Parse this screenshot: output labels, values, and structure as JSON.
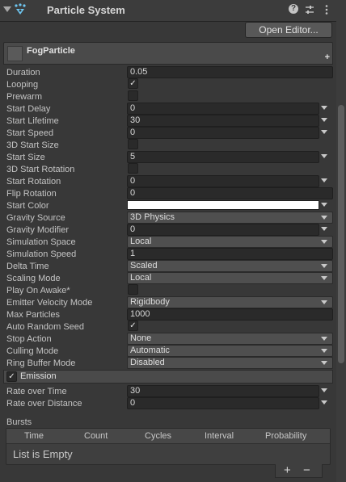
{
  "header": {
    "title": "Particle System"
  },
  "open_editor_label": "Open Editor...",
  "module_title": "FogParticle",
  "main": {
    "duration": {
      "label": "Duration",
      "value": "0.05"
    },
    "looping": {
      "label": "Looping",
      "checked": true
    },
    "prewarm": {
      "label": "Prewarm",
      "checked": false
    },
    "start_delay": {
      "label": "Start Delay",
      "value": "0"
    },
    "start_lifetime": {
      "label": "Start Lifetime",
      "value": "30"
    },
    "start_speed": {
      "label": "Start Speed",
      "value": "0"
    },
    "start_size_3d": {
      "label": "3D Start Size",
      "checked": false
    },
    "start_size": {
      "label": "Start Size",
      "value": "5"
    },
    "start_rotation_3d": {
      "label": "3D Start Rotation",
      "checked": false
    },
    "start_rotation": {
      "label": "Start Rotation",
      "value": "0"
    },
    "flip_rotation": {
      "label": "Flip Rotation",
      "value": "0"
    },
    "start_color": {
      "label": "Start Color",
      "color": "#ffffff"
    },
    "gravity_source": {
      "label": "Gravity Source",
      "value": "3D Physics"
    },
    "gravity_modifier": {
      "label": "Gravity Modifier",
      "value": "0"
    },
    "simulation_space": {
      "label": "Simulation Space",
      "value": "Local"
    },
    "simulation_speed": {
      "label": "Simulation Speed",
      "value": "1"
    },
    "delta_time": {
      "label": "Delta Time",
      "value": "Scaled"
    },
    "scaling_mode": {
      "label": "Scaling Mode",
      "value": "Local"
    },
    "play_on_awake": {
      "label": "Play On Awake*",
      "checked": false
    },
    "emitter_velocity_mode": {
      "label": "Emitter Velocity Mode",
      "value": "Rigidbody"
    },
    "max_particles": {
      "label": "Max Particles",
      "value": "1000"
    },
    "auto_random_seed": {
      "label": "Auto Random Seed",
      "checked": true
    },
    "stop_action": {
      "label": "Stop Action",
      "value": "None"
    },
    "culling_mode": {
      "label": "Culling Mode",
      "value": "Automatic"
    },
    "ring_buffer_mode": {
      "label": "Ring Buffer Mode",
      "value": "Disabled"
    }
  },
  "emission": {
    "title": "Emission",
    "enabled": true,
    "rate_over_time": {
      "label": "Rate over Time",
      "value": "30"
    },
    "rate_over_distance": {
      "label": "Rate over Distance",
      "value": "0"
    },
    "bursts": {
      "label": "Bursts",
      "columns": [
        "Time",
        "Count",
        "Cycles",
        "Interval",
        "Probability"
      ],
      "empty_text": "List is Empty",
      "add_label": "+",
      "remove_label": "−"
    }
  },
  "colors": {
    "panel_bg": "#383838",
    "field_bg": "#2a2a2a",
    "dropdown_bg": "#4f4f4f",
    "icon_accent": "#6ec6f0"
  }
}
